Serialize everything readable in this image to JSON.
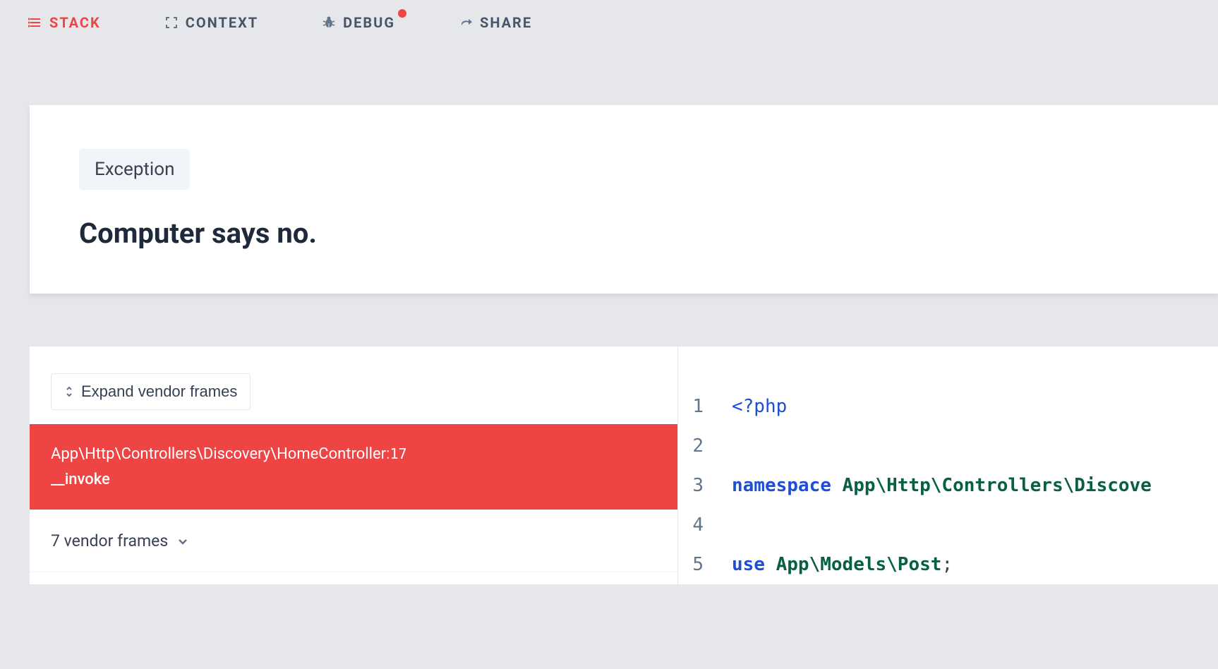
{
  "nav": {
    "stack": "STACK",
    "context": "CONTEXT",
    "debug": "DEBUG",
    "share": "SHARE"
  },
  "error": {
    "badge": "Exception",
    "message": "Computer says no."
  },
  "stack": {
    "expand_label": "Expand vendor frames",
    "active_frame": {
      "path": "App\\Http\\Controllers\\Discovery\\HomeController",
      "line": "17",
      "method": "__invoke"
    },
    "vendor_frames_label": "7 vendor frames"
  },
  "code": {
    "lines": [
      {
        "num": "1",
        "tokens": [
          {
            "text": "<?php",
            "cls": "tok-tag"
          }
        ]
      },
      {
        "num": "2",
        "tokens": []
      },
      {
        "num": "3",
        "tokens": [
          {
            "text": "namespace ",
            "cls": "tok-keyword"
          },
          {
            "text": "App\\Http\\Controllers\\Discove",
            "cls": "tok-ns"
          }
        ]
      },
      {
        "num": "4",
        "tokens": []
      },
      {
        "num": "5",
        "tokens": [
          {
            "text": "use ",
            "cls": "tok-keyword"
          },
          {
            "text": "App\\Models\\Post",
            "cls": "tok-ns"
          },
          {
            "text": ";",
            "cls": "tok-punct"
          }
        ]
      }
    ]
  }
}
